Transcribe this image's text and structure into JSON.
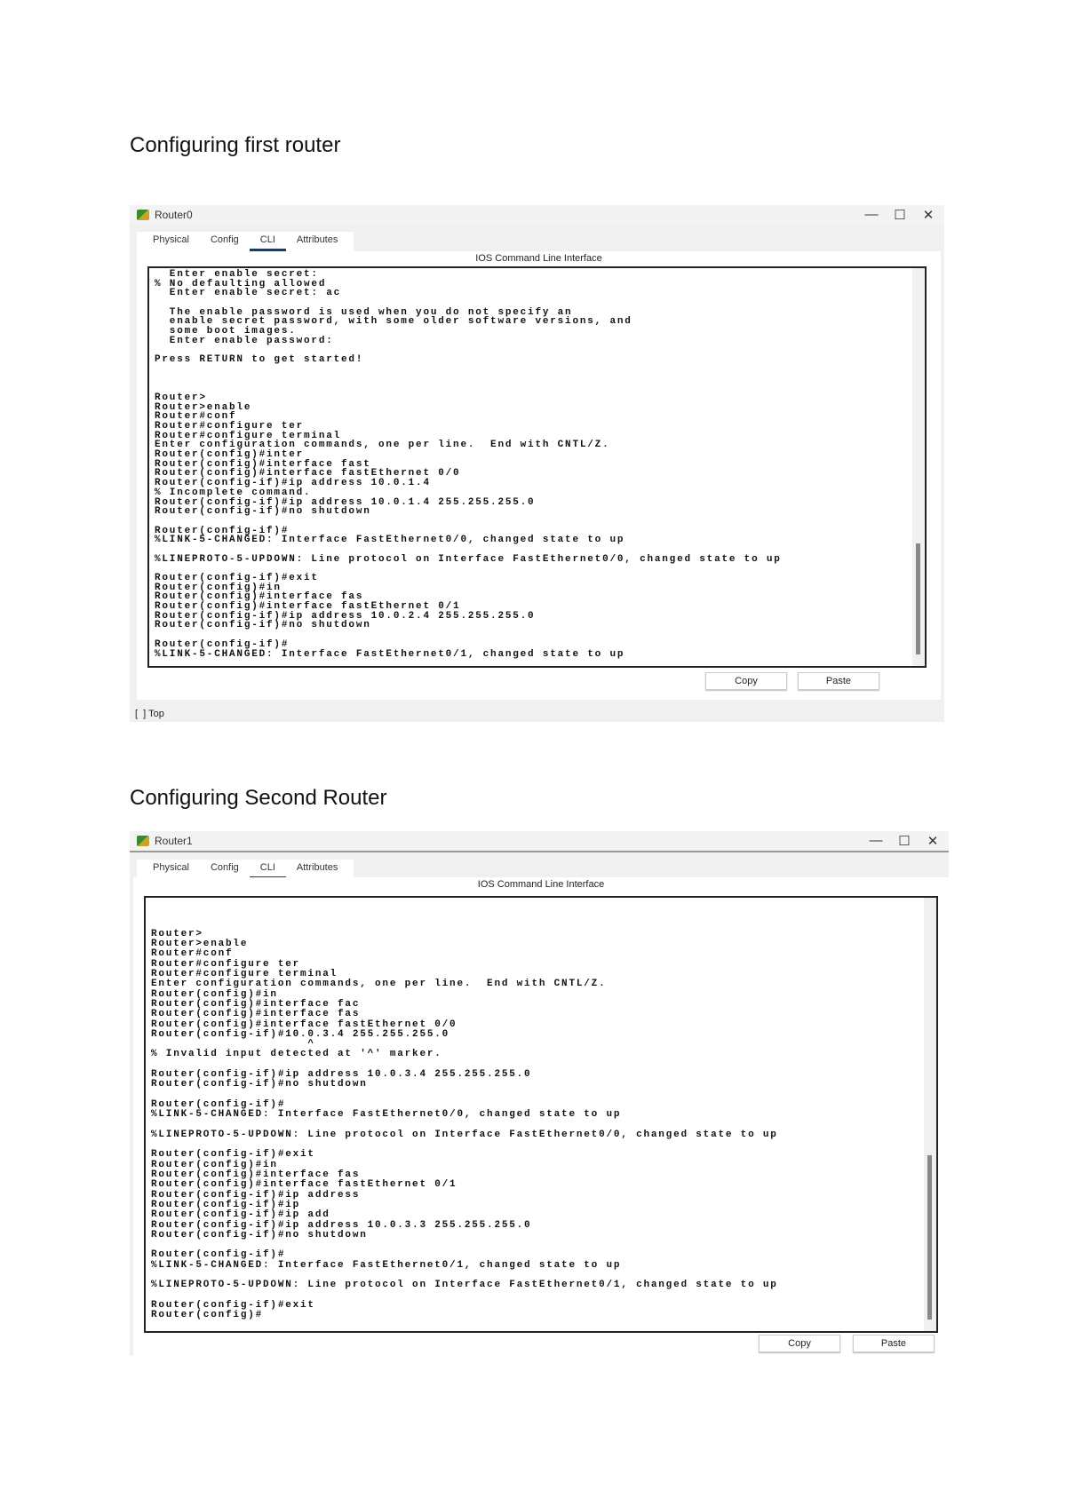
{
  "sections": [
    {
      "heading": "Configuring first router",
      "window": {
        "title": "Router0",
        "tabs": [
          "Physical",
          "Config",
          "CLI",
          "Attributes"
        ],
        "active_tab": "CLI",
        "cli_label": "IOS Command Line Interface",
        "lines": [
          "  Enter enable secret:",
          "% No defaulting allowed",
          "  Enter enable secret: ac",
          "",
          "  The enable password is used when you do not specify an",
          "  enable secret password, with some older software versions, and",
          "  some boot images.",
          "  Enter enable password:",
          "",
          "Press RETURN to get started!",
          "",
          "",
          "",
          "Router>",
          "Router>enable",
          "Router#conf",
          "Router#configure ter",
          "Router#configure terminal",
          "Enter configuration commands, one per line.  End with CNTL/Z.",
          "Router(config)#inter",
          "Router(config)#interface fast",
          "Router(config)#interface fastEthernet 0/0",
          "Router(config-if)#ip address 10.0.1.4",
          "% Incomplete command.",
          "Router(config-if)#ip address 10.0.1.4 255.255.255.0",
          "Router(config-if)#no shutdown",
          "",
          "Router(config-if)#",
          "%LINK-5-CHANGED: Interface FastEthernet0/0, changed state to up",
          "",
          "%LINEPROTO-5-UPDOWN: Line protocol on Interface FastEthernet0/0, changed state to up",
          "",
          "Router(config-if)#exit",
          "Router(config)#in",
          "Router(config)#interface fas",
          "Router(config)#interface fastEthernet 0/1",
          "Router(config-if)#ip address 10.0.2.4 255.255.255.0",
          "Router(config-if)#no shutdown",
          "",
          "Router(config-if)#",
          "%LINK-5-CHANGED: Interface FastEthernet0/1, changed state to up"
        ],
        "copy": "Copy",
        "paste": "Paste",
        "top_label": "Top",
        "min": "—",
        "max": "☐",
        "close": "✕"
      }
    },
    {
      "heading": "Configuring Second Router",
      "window": {
        "title": "Router1",
        "tabs": [
          "Physical",
          "Config",
          "CLI",
          "Attributes"
        ],
        "active_tab": "CLI",
        "cli_label": "IOS Command Line Interface",
        "lines": [
          "",
          "",
          "",
          "Router>",
          "Router>enable",
          "Router#conf",
          "Router#configure ter",
          "Router#configure terminal",
          "Enter configuration commands, one per line.  End with CNTL/Z.",
          "Router(config)#in",
          "Router(config)#interface fac",
          "Router(config)#interface fas",
          "Router(config)#interface fastEthernet 0/0",
          "Router(config-if)#10.0.3.4 255.255.255.0",
          "                     ^",
          "% Invalid input detected at '^' marker.",
          "",
          "Router(config-if)#ip address 10.0.3.4 255.255.255.0",
          "Router(config-if)#no shutdown",
          "",
          "Router(config-if)#",
          "%LINK-5-CHANGED: Interface FastEthernet0/0, changed state to up",
          "",
          "%LINEPROTO-5-UPDOWN: Line protocol on Interface FastEthernet0/0, changed state to up",
          "",
          "Router(config-if)#exit",
          "Router(config)#in",
          "Router(config)#interface fas",
          "Router(config)#interface fastEthernet 0/1",
          "Router(config-if)#ip address",
          "Router(config-if)#ip",
          "Router(config-if)#ip add",
          "Router(config-if)#ip address 10.0.3.3 255.255.255.0",
          "Router(config-if)#no shutdown",
          "",
          "Router(config-if)#",
          "%LINK-5-CHANGED: Interface FastEthernet0/1, changed state to up",
          "",
          "%LINEPROTO-5-UPDOWN: Line protocol on Interface FastEthernet0/1, changed state to up",
          "",
          "Router(config-if)#exit",
          "Router(config)#"
        ],
        "copy": "Copy",
        "paste": "Paste",
        "min": "—",
        "max": "☐",
        "close": "✕"
      }
    }
  ]
}
